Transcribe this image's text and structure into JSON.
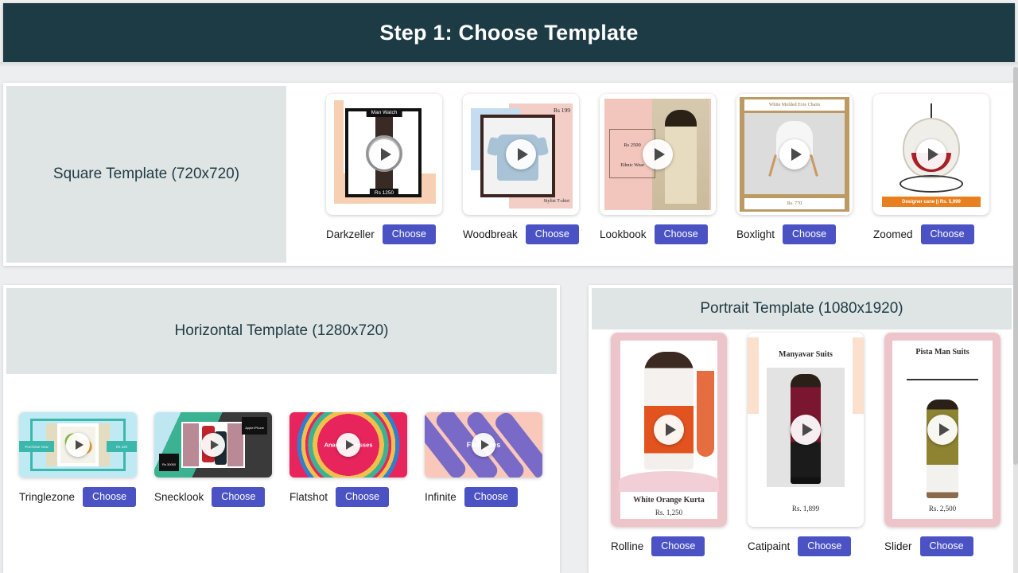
{
  "header": {
    "title": "Step 1: Choose Template"
  },
  "choose_label": "Choose",
  "accent": "#4b53c4",
  "header_bg": "#1d3b44",
  "sections": {
    "square": {
      "heading": "Square Template (720x720)",
      "items": [
        {
          "name": "Darkzeller",
          "art": {
            "top_tag": "Man Watch",
            "bottom_tag": "Rs 1250"
          }
        },
        {
          "name": "Woodbreak",
          "art": {
            "price": "Rs 199",
            "caption": "Stylist T-shirt"
          }
        },
        {
          "name": "Lookbook",
          "art": {
            "price": "Rs 2500",
            "caption": "Ethnic Wear"
          }
        },
        {
          "name": "Boxlight",
          "art": {
            "title": "White Molded Evie Chairs",
            "price": "Rs. 770"
          }
        },
        {
          "name": "Zoomed",
          "art": {
            "tag": "Designer cane || Rs. 5,999"
          }
        }
      ]
    },
    "horizontal": {
      "heading": "Horizontal Template (1280x720)",
      "items": [
        {
          "name": "Tringlezone",
          "art": {
            "left_label": "Purchase Now",
            "right_label": "Rs 120"
          }
        },
        {
          "name": "Snecklook",
          "art": {
            "top_label": "Apple iPhone",
            "bottom_label": "Rs 30000"
          }
        },
        {
          "name": "Flatshot",
          "art": {
            "title": "Anarkali Dresses"
          }
        },
        {
          "name": "Infinite",
          "art": {
            "title": "Flat Soles"
          }
        }
      ]
    },
    "portrait": {
      "heading": "Portrait Template (1080x1920)",
      "items": [
        {
          "name": "Rolline",
          "art": {
            "title": "White Orange Kurta",
            "price": "Rs. 1,250"
          }
        },
        {
          "name": "Catipaint",
          "art": {
            "title": "Manyavar Suits",
            "price": "Rs. 1,899"
          }
        },
        {
          "name": "Slider",
          "art": {
            "title": "Pista Man Suits",
            "price": "Rs. 2,500"
          }
        }
      ]
    }
  }
}
